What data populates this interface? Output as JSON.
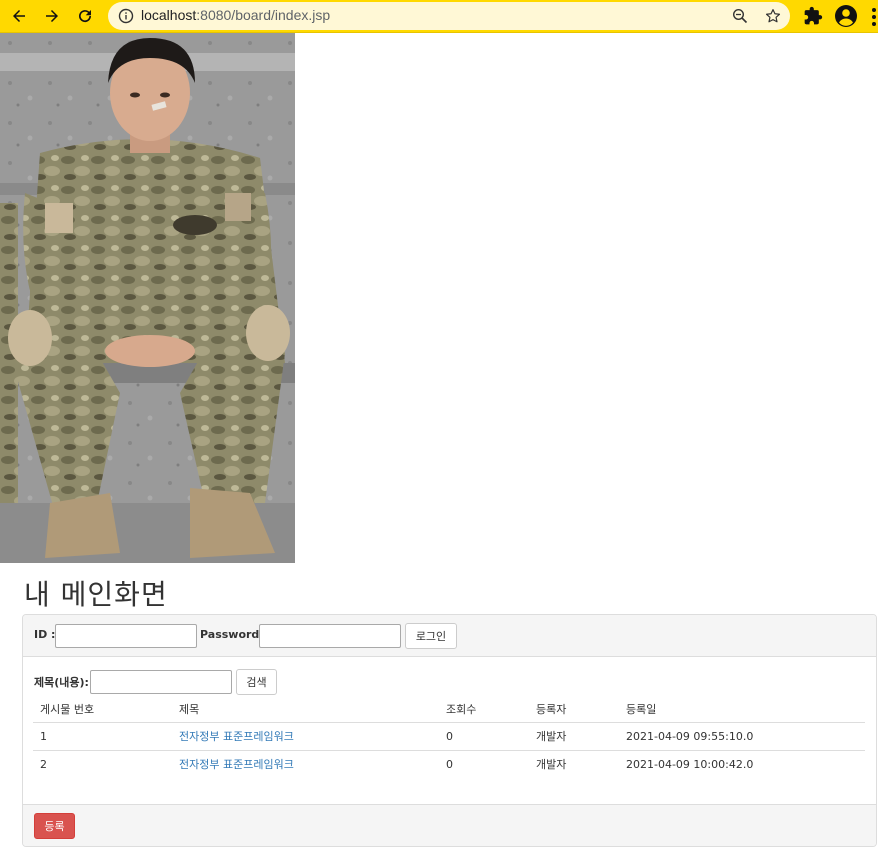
{
  "browser": {
    "url_host": "localhost",
    "url_rest": ":8080/board/index.jsp"
  },
  "page": {
    "title": "내 메인화면"
  },
  "login": {
    "id_label": "ID :",
    "id_value": "",
    "password_label": "Password :",
    "password_value": "",
    "login_button": "로그인"
  },
  "search": {
    "label": "제목(내용):",
    "value": "",
    "button": "검색"
  },
  "table": {
    "headers": [
      "게시물 번호",
      "제목",
      "조회수",
      "등록자",
      "등록일"
    ],
    "rows": [
      [
        "1",
        "전자정부 표준프레임워크",
        "0",
        "개발자",
        "2021-04-09 09:55:10.0"
      ],
      [
        "2",
        "전자정부 표준프레임워크",
        "0",
        "개발자",
        "2021-04-09 10:00:42.0"
      ]
    ]
  },
  "footer": {
    "register_button": "등록"
  },
  "colors": {
    "chrome": "#ffd900",
    "link": "#337ab7",
    "danger": "#d9534f"
  }
}
